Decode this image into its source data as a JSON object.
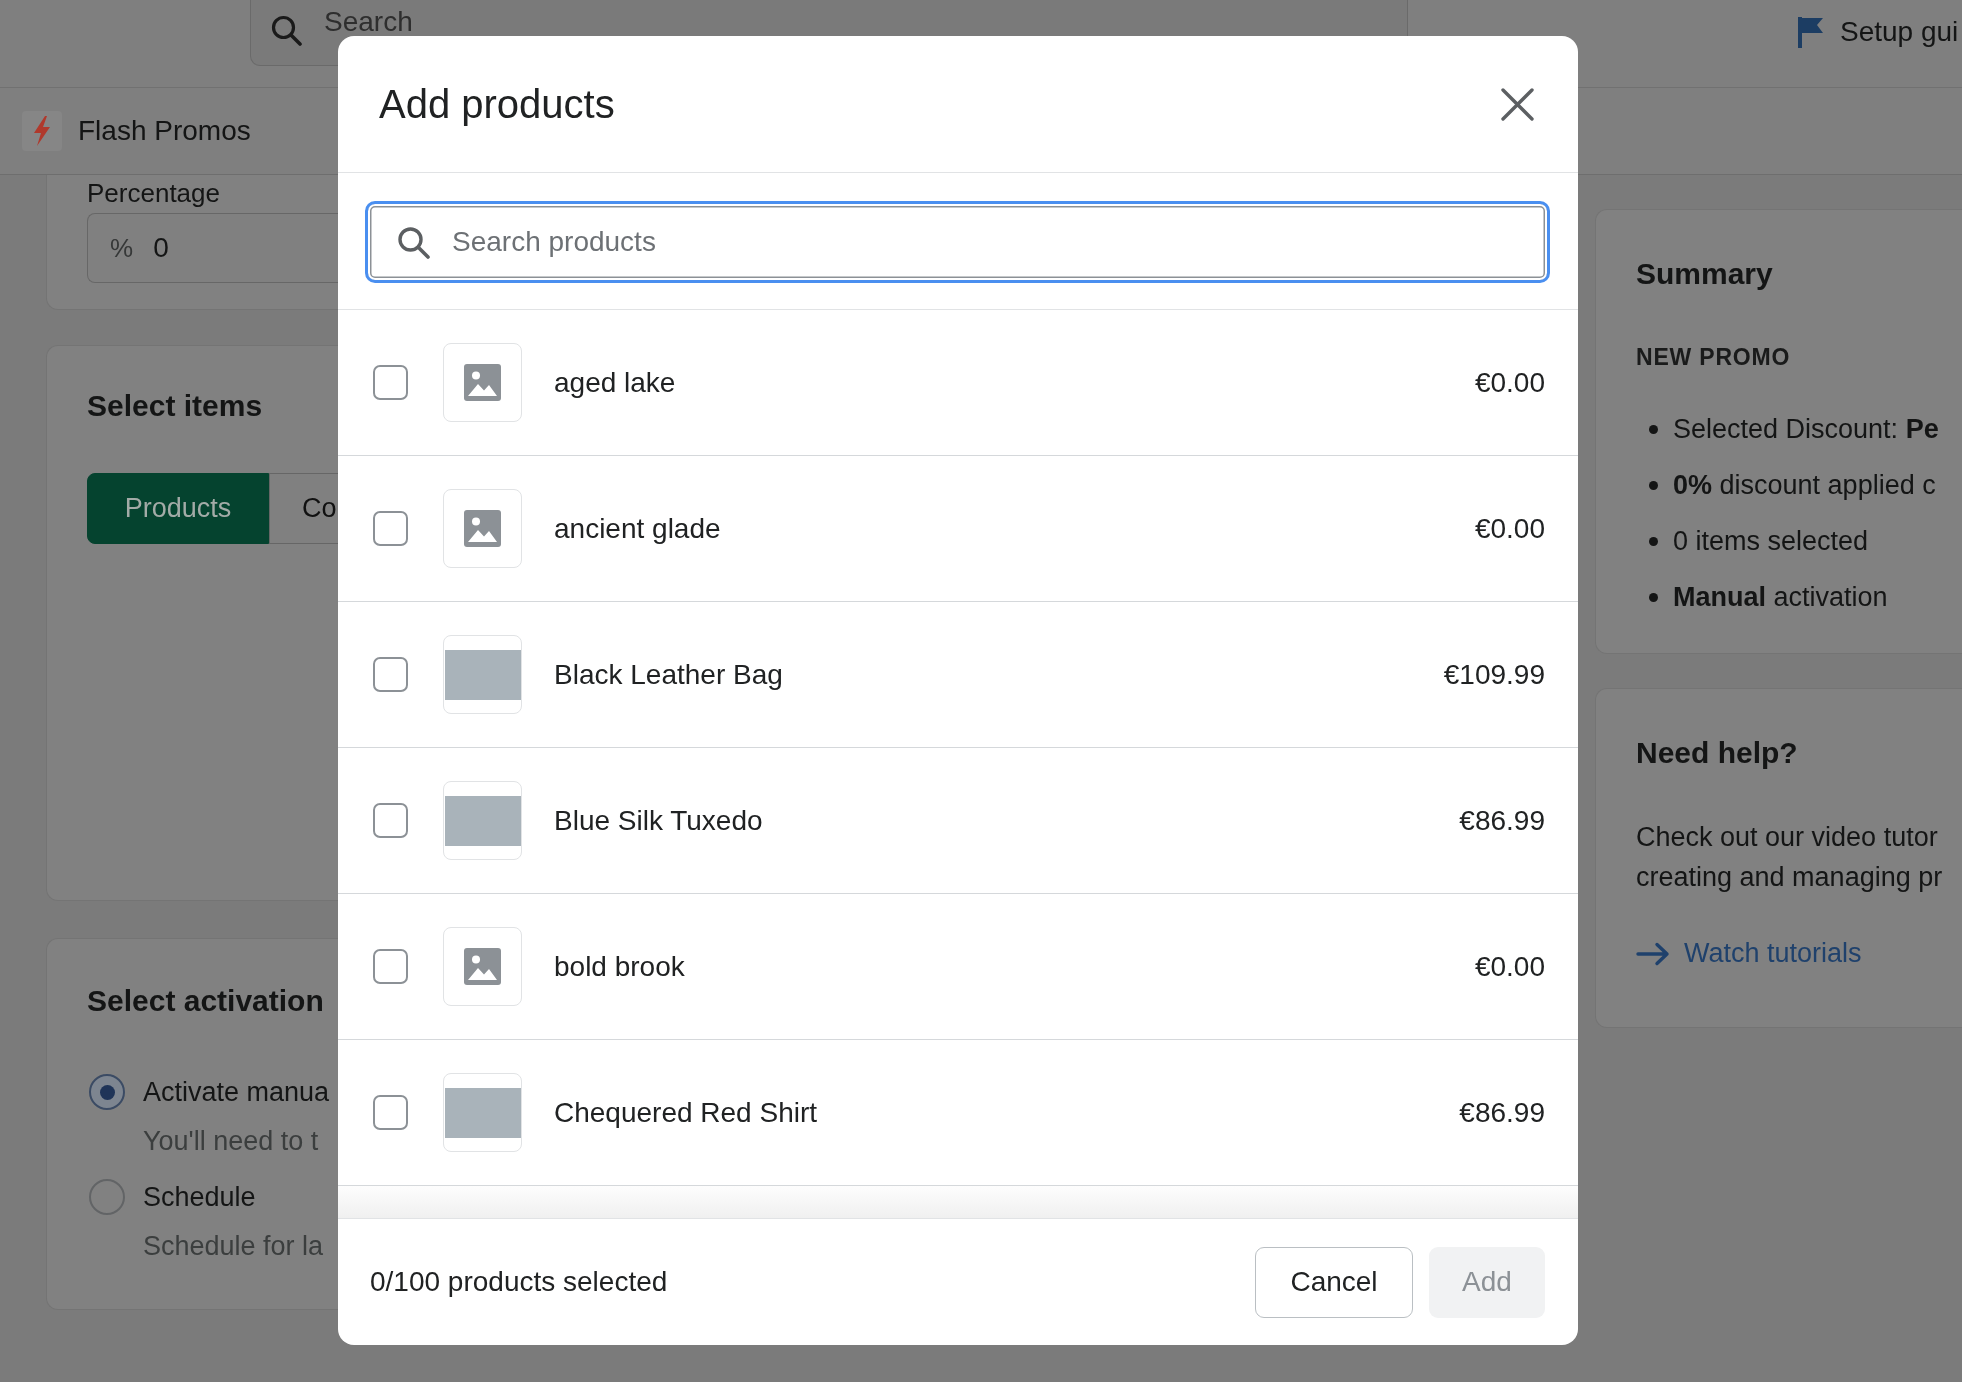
{
  "top_bar": {
    "search": {
      "placeholder": "Search"
    },
    "setup_guide": {
      "label": "Setup gui"
    }
  },
  "app_bar": {
    "title": "Flash Promos"
  },
  "discount_card": {
    "field_label": "Percentage",
    "prefix": "%",
    "value": "0"
  },
  "items_card": {
    "title": "Select items",
    "tabs": [
      {
        "label": "Products",
        "selected": true
      },
      {
        "label": "Co",
        "selected": false
      }
    ]
  },
  "activation_card": {
    "title": "Select activation",
    "options": [
      {
        "label": "Activate manua",
        "description": "You'll need to t",
        "selected": true
      },
      {
        "label": "Schedule",
        "description": "Schedule for la",
        "selected": false
      }
    ]
  },
  "summary_card": {
    "title": "Summary",
    "subtitle": "NEW PROMO",
    "items": [
      "Selected Discount: **Pe**",
      "**0%** discount applied c",
      "0 items selected",
      "**Manual** activation"
    ]
  },
  "help_card": {
    "title": "Need help?",
    "body_lines": [
      "Check out our video tutor",
      "creating and managing pr"
    ],
    "link": "Watch tutorials"
  },
  "modal": {
    "title": "Add products",
    "search": {
      "placeholder": "Search products",
      "focused": true
    },
    "products": [
      {
        "name": "aged lake",
        "price": "€0.00",
        "kind": "placeholder",
        "checked": false
      },
      {
        "name": "ancient glade",
        "price": "€0.00",
        "kind": "placeholder",
        "checked": false
      },
      {
        "name": "Black Leather Bag",
        "price": "€109.99",
        "kind": "photo",
        "checked": false
      },
      {
        "name": "Blue Silk Tuxedo",
        "price": "€86.99",
        "kind": "photo",
        "checked": false
      },
      {
        "name": "bold brook",
        "price": "€0.00",
        "kind": "placeholder",
        "checked": false
      },
      {
        "name": "Chequered Red Shirt",
        "price": "€86.99",
        "kind": "photo",
        "checked": false
      }
    ],
    "footer": {
      "count": "0/100 products selected",
      "buttons": [
        {
          "label": "Cancel",
          "kind": "secondary",
          "disabled": false
        },
        {
          "label": "Add",
          "kind": "primary",
          "disabled": true
        }
      ]
    }
  }
}
